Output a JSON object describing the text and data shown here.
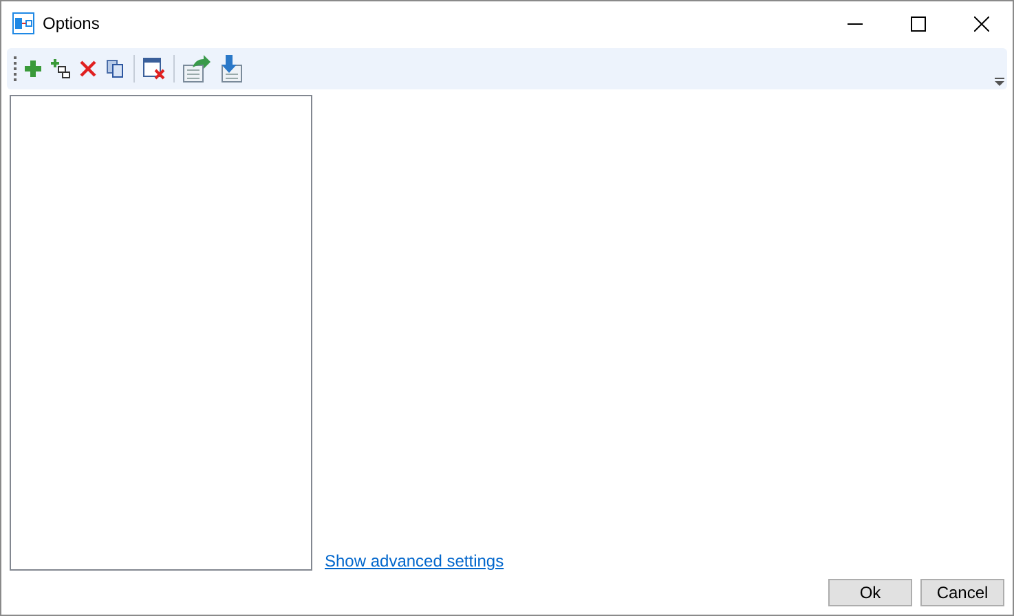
{
  "window": {
    "title": "Options"
  },
  "advanced_link": "Show advanced settings",
  "buttons": [
    "Ok",
    "Cancel"
  ]
}
